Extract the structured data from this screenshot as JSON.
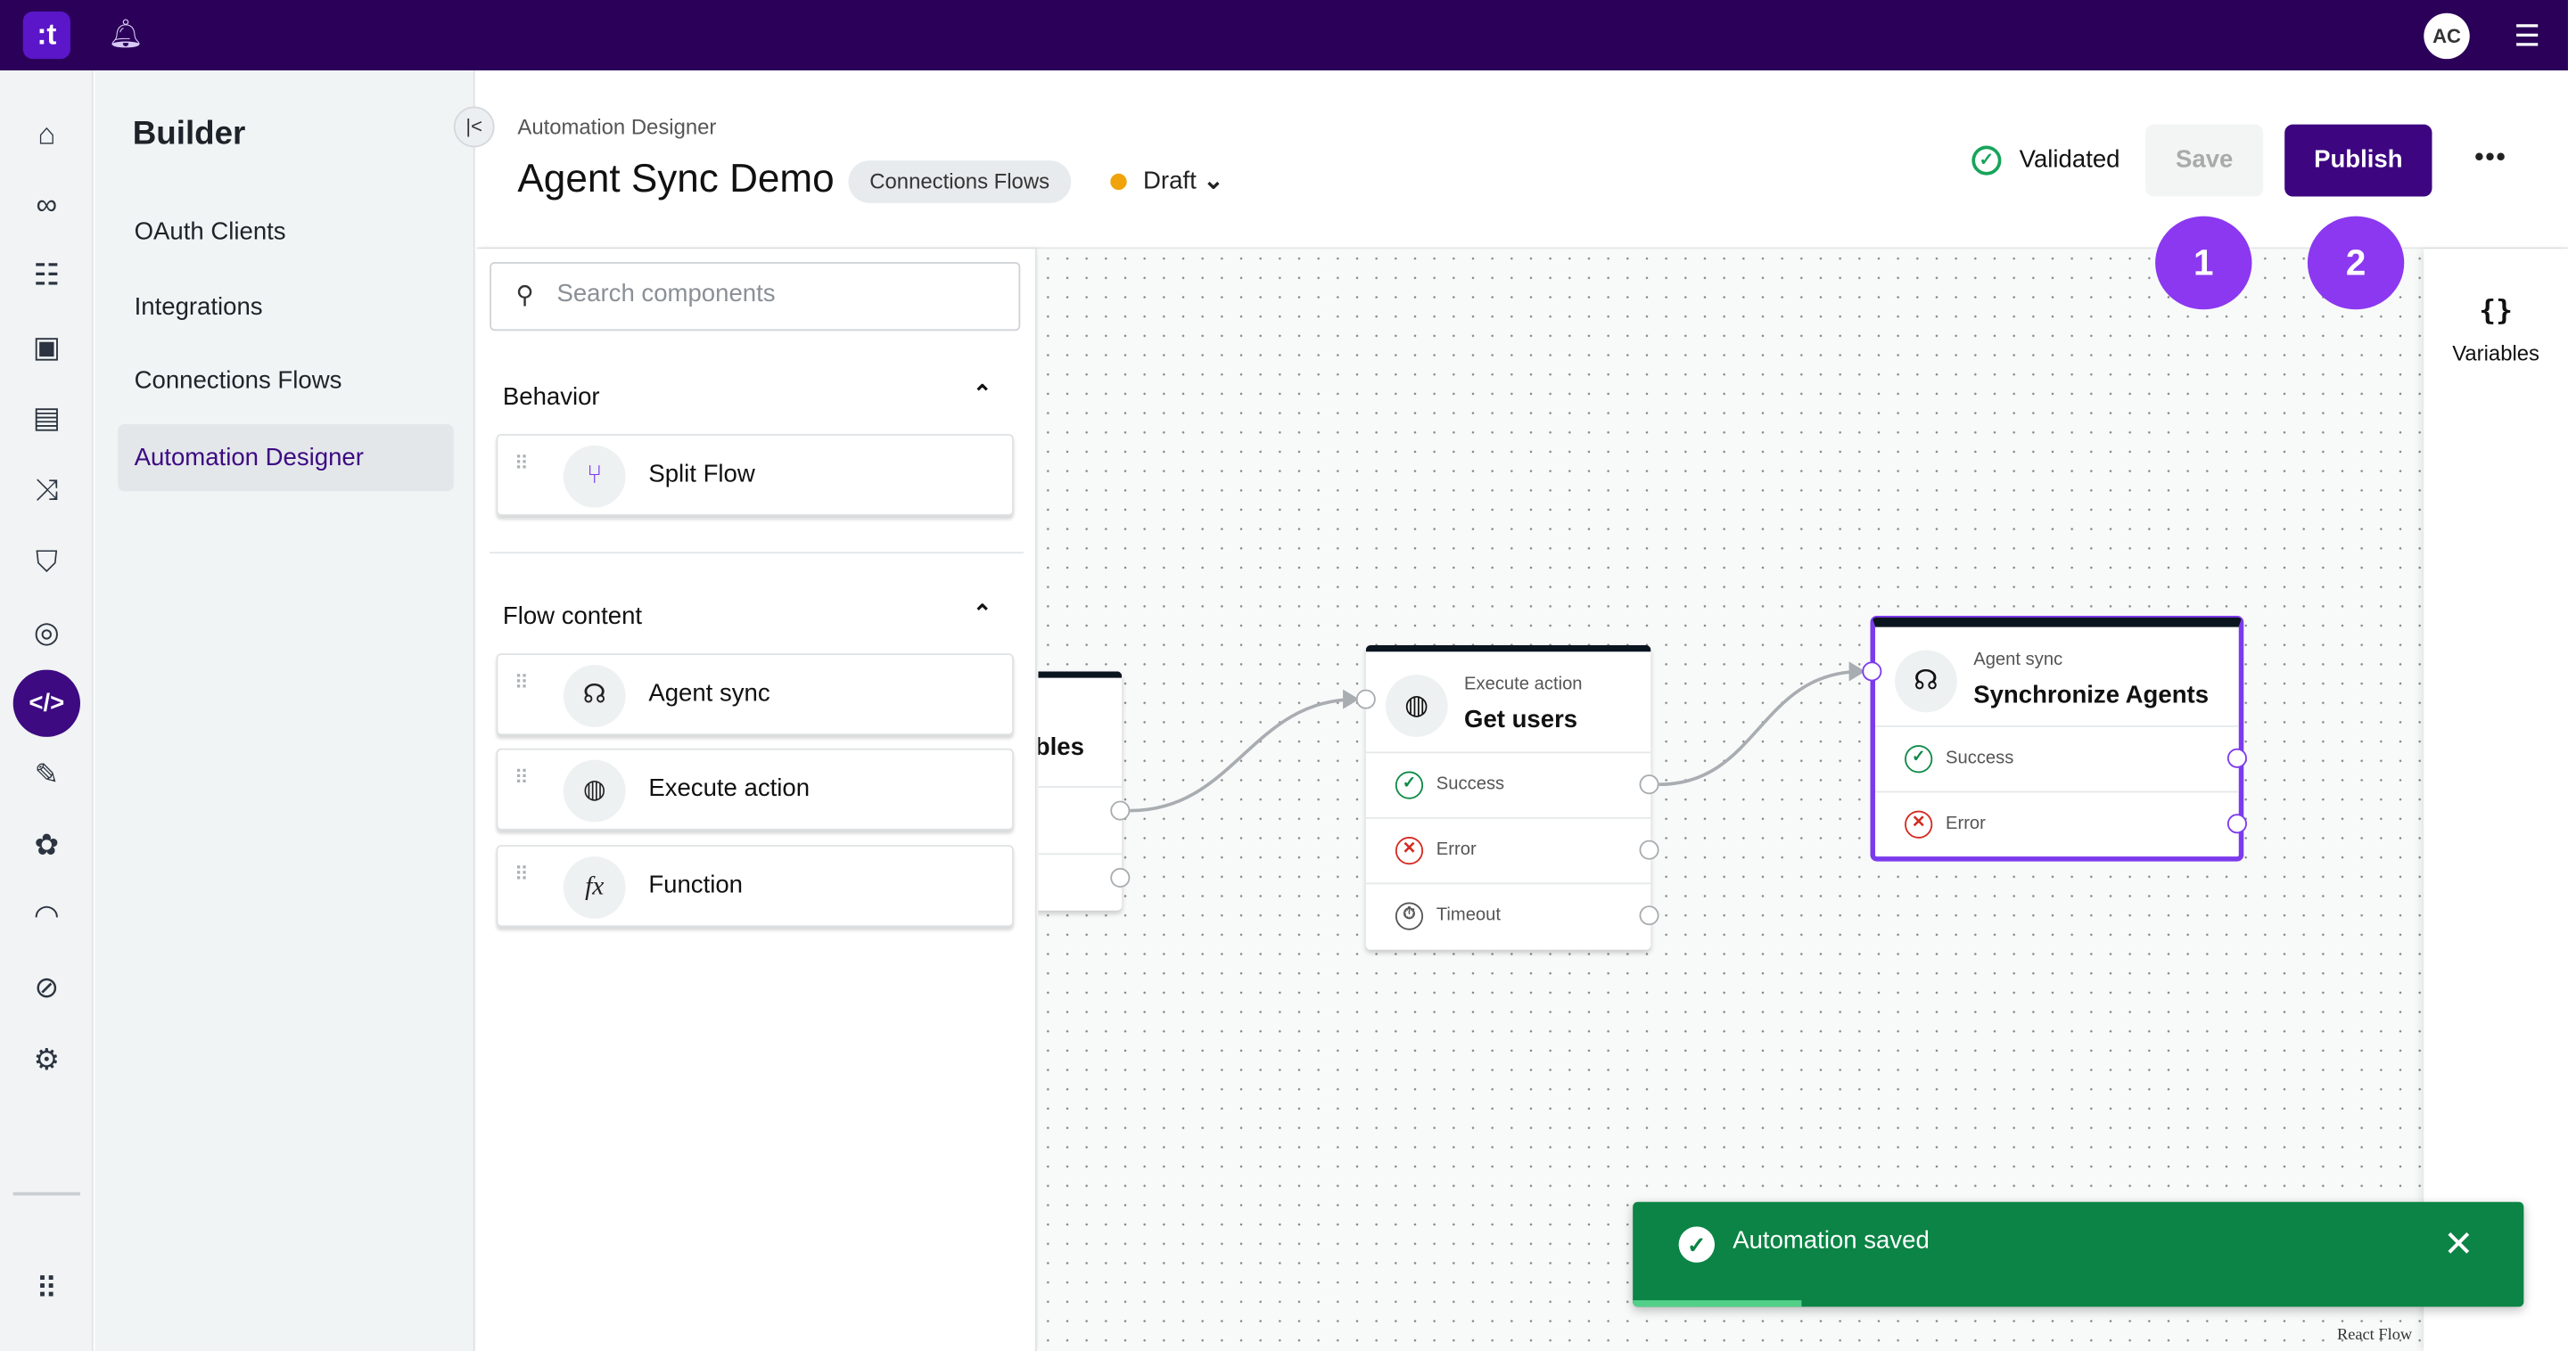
{
  "topbar": {
    "logo": ":t",
    "avatar": "AC",
    "icons": [
      "bell-icon",
      "panel-toggle-icon"
    ]
  },
  "rail": {
    "items": [
      "home-icon",
      "infinity-icon",
      "list-icon",
      "contacts-icon",
      "book-icon",
      "flow-icon",
      "shield-icon",
      "fingerprint-icon",
      "code-icon",
      "edit-icon",
      "brain-icon",
      "gauge-icon",
      "compass-icon",
      "gear-icon",
      "apps-grid-icon"
    ],
    "active": "code-icon"
  },
  "sidebar": {
    "title": "Builder",
    "items": [
      {
        "label": "OAuth Clients"
      },
      {
        "label": "Integrations"
      },
      {
        "label": "Connections Flows"
      },
      {
        "label": "Automation Designer",
        "active": true
      }
    ]
  },
  "header": {
    "breadcrumb": "Automation Designer",
    "title": "Agent Sync Demo",
    "chip": "Connections Flows",
    "status": "Draft",
    "validation": "Validated",
    "save_label": "Save",
    "publish_label": "Publish",
    "save_disabled": true
  },
  "components": {
    "search_placeholder": "Search components",
    "sections": [
      {
        "title": "Behavior",
        "items": [
          {
            "label": "Split Flow",
            "icon": "split-icon"
          }
        ]
      },
      {
        "title": "Flow content",
        "items": [
          {
            "label": "Agent sync",
            "icon": "headset-icon"
          },
          {
            "label": "Execute action",
            "icon": "globe-icon"
          },
          {
            "label": "Function",
            "icon": "function-icon"
          }
        ]
      }
    ]
  },
  "canvas": {
    "partial_node_text": "bles",
    "nodes": [
      {
        "type": "Execute action",
        "name": "Get users",
        "outputs": [
          "Success",
          "Error",
          "Timeout"
        ]
      },
      {
        "type": "Agent sync",
        "name": "Synchronize Agents",
        "outputs": [
          "Success",
          "Error"
        ],
        "selected": true
      }
    ],
    "attribution": "React Flow"
  },
  "badges": [
    "1",
    "2"
  ],
  "variables": {
    "icon": "{}",
    "label": "Variables"
  },
  "toast": {
    "message": "Automation saved",
    "progress": 0.19
  },
  "colors": {
    "topbar": "#2b0058",
    "accent": "#3d0680",
    "selection": "#7c3aed",
    "badge": "#8b38f0",
    "toast": "#0b8445",
    "draft": "#f0a30a"
  }
}
